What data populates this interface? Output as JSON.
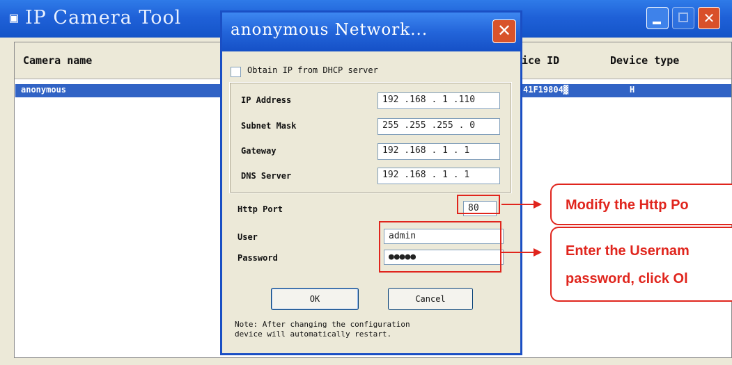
{
  "app": {
    "title": "IP Camera Tool",
    "icon": "camera-app-icon",
    "window_buttons": {
      "minimize": "minimize-icon",
      "maximize": "maximize-icon",
      "close": "close-icon",
      "close_glyph": "✕"
    }
  },
  "list": {
    "columns": [
      "Camera name",
      "ice ID",
      "Device type"
    ],
    "rows": [
      {
        "camera_name": "anonymous",
        "device_id": "41F19804▓",
        "device_type": "H"
      }
    ]
  },
  "dialog": {
    "title": "anonymous Network...",
    "close_glyph": "✕",
    "dhcp": {
      "label": "Obtain IP from DHCP server",
      "checked": false
    },
    "fields": {
      "ip": {
        "label": "IP Address",
        "value": "192 .168 . 1  .110"
      },
      "mask": {
        "label": "Subnet Mask",
        "value": "255 .255 .255 . 0"
      },
      "gateway": {
        "label": "Gateway",
        "value": "192 .168 . 1  . 1"
      },
      "dns": {
        "label": "DNS Server",
        "value": "192 .168 . 1  . 1"
      },
      "http_port": {
        "label": "Http Port",
        "value": "80"
      },
      "user": {
        "label": "User",
        "value": "admin"
      },
      "password": {
        "label": "Password",
        "value": "●●●●●"
      }
    },
    "ok_label": "OK",
    "cancel_label": "Cancel",
    "note": "Note: After changing the configuration\ndevice will automatically restart."
  },
  "callouts": {
    "http_port": "Modify the Http Po",
    "credentials_line1": "Enter the Usernam",
    "credentials_line2": "password, click Ol"
  },
  "colors": {
    "accent_red": "#e0251d",
    "title_blue": "#1f61d8",
    "selection_blue": "#3163c5"
  }
}
